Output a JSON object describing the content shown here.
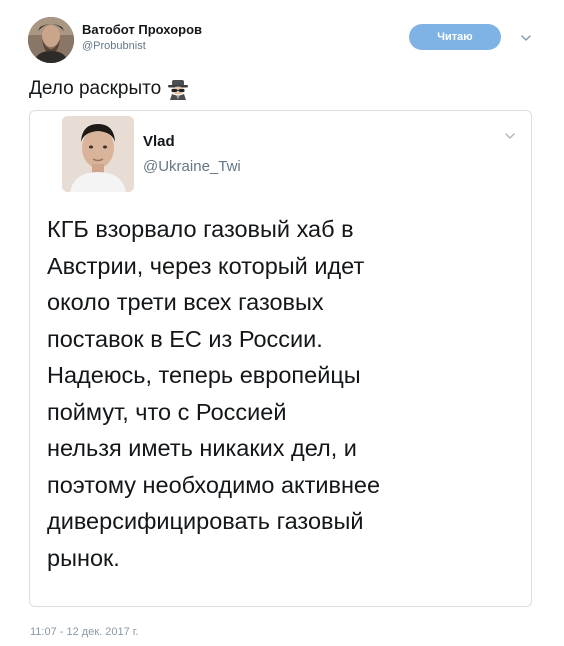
{
  "tweet": {
    "author_name": "Ватобот Прохоров",
    "author_handle": "@Probubnist",
    "follow_label": "Читаю",
    "text": "Дело раскрыто",
    "emoji_icon": "detective-icon",
    "timestamp": "11:07 - 12 дек. 2017 г."
  },
  "quoted": {
    "author_name": "Vlad",
    "author_handle": "@Ukraine_Twi",
    "lines": [
      "КГБ взорвало газовый хаб в",
      "Австрии, через который идет",
      "около трети всех газовых",
      "поставок в ЕС из России.",
      "Надеюсь, теперь европейцы",
      "поймут, что с Россией",
      "нельзя иметь никаких дел, и",
      "поэтому необходимо активнее",
      "диверсифицировать газовый",
      "рынок."
    ]
  },
  "colors": {
    "follow_button": "#7fb3e6",
    "secondary_text": "#657786",
    "card_border": "#d8dee3"
  }
}
